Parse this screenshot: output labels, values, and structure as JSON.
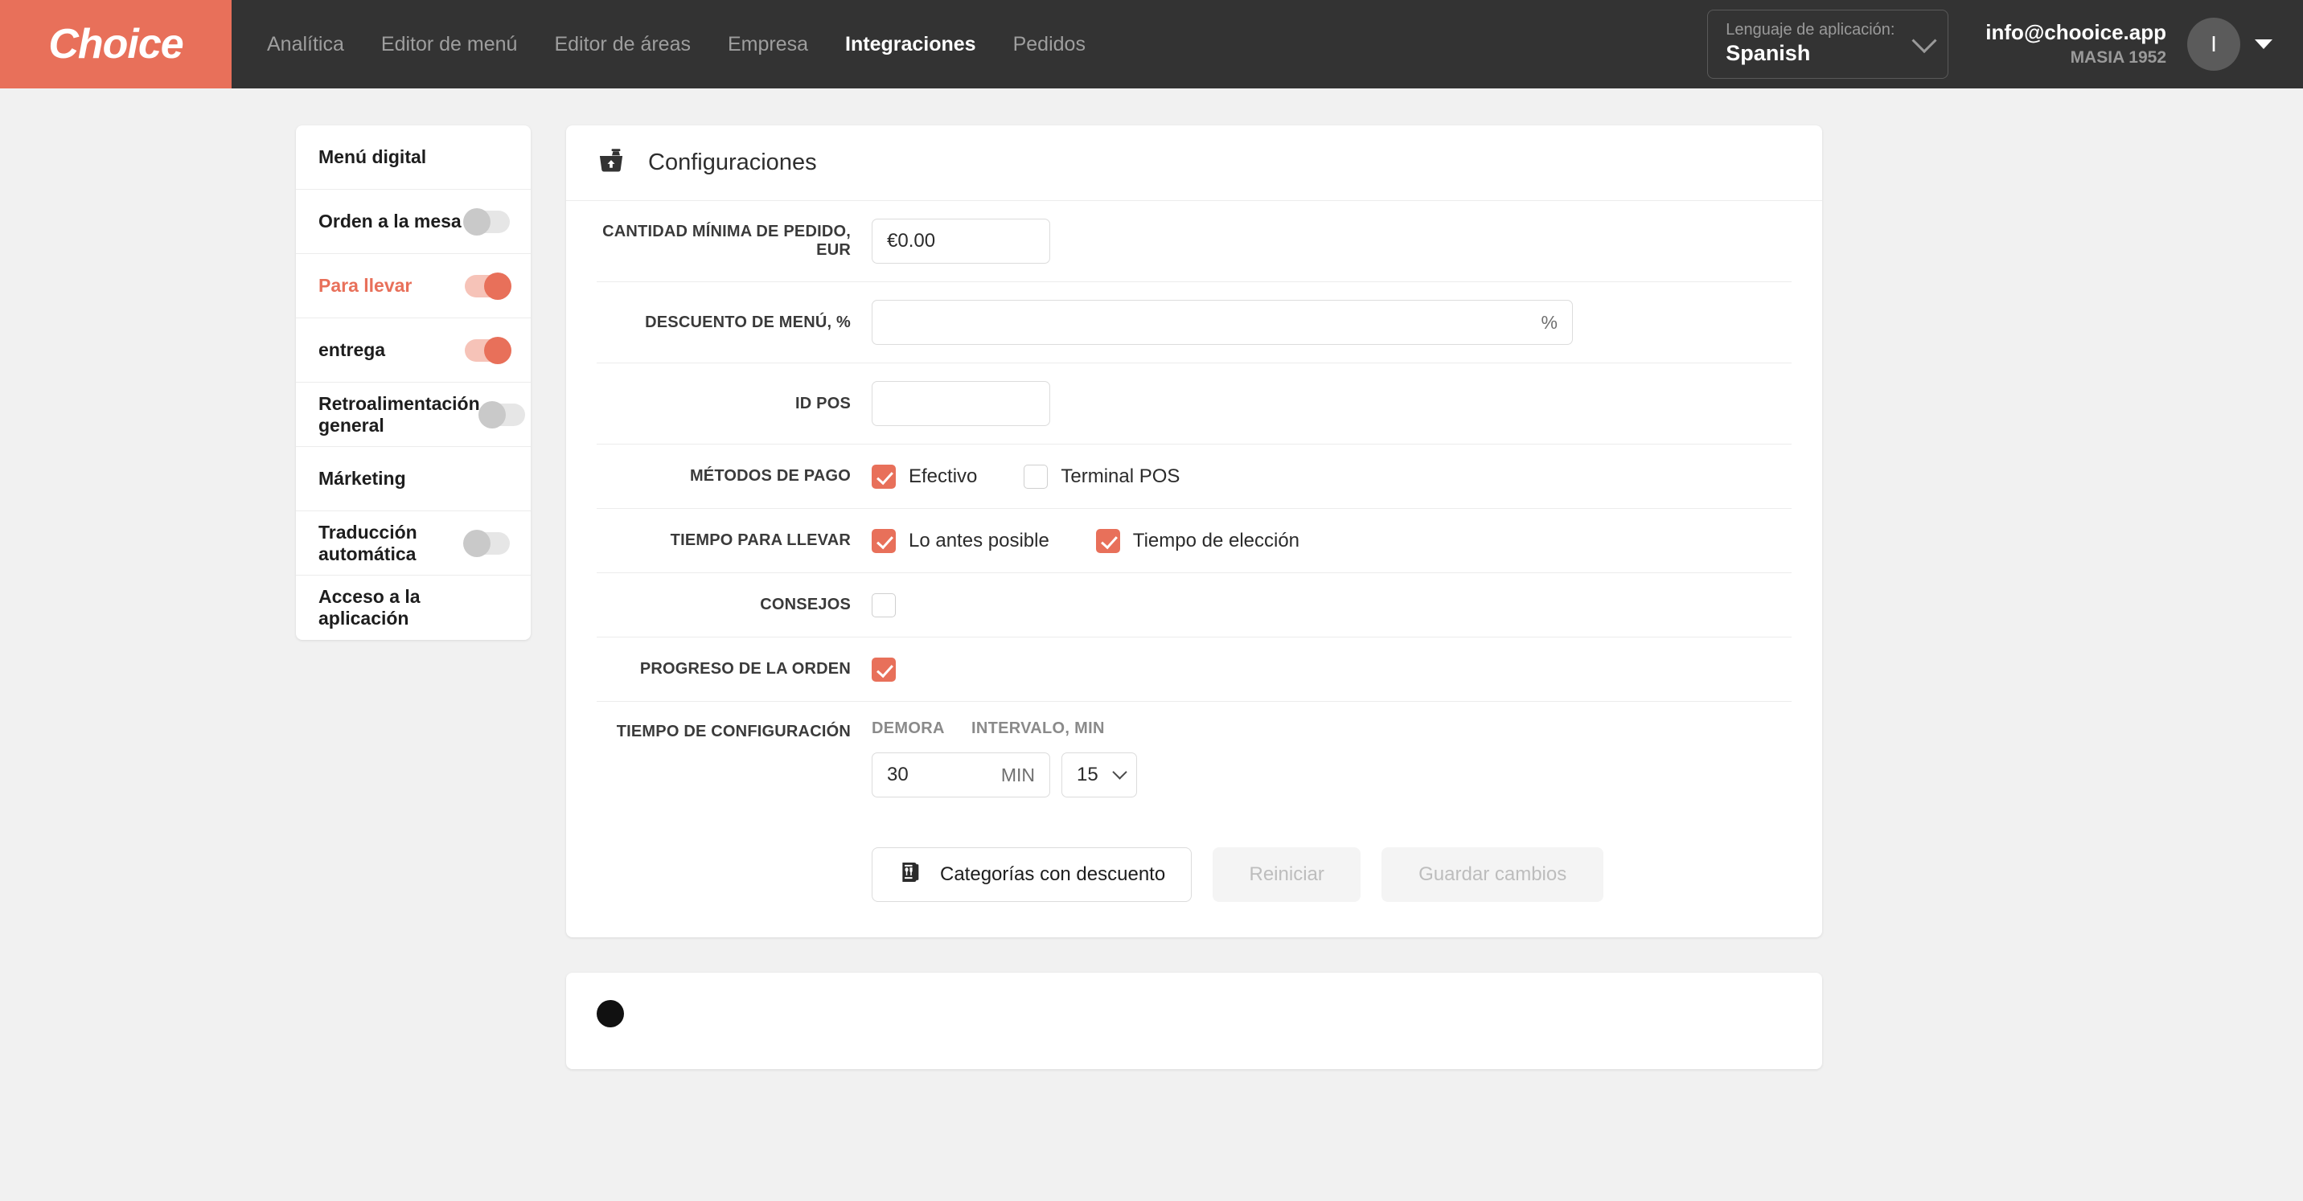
{
  "brand": {
    "logo_text": "Choice",
    "accent": "#E8705A",
    "header_bg": "#333333"
  },
  "topnav": {
    "items": [
      {
        "label": "Analítica",
        "active": false
      },
      {
        "label": "Editor de menú",
        "active": false
      },
      {
        "label": "Editor de áreas",
        "active": false
      },
      {
        "label": "Empresa",
        "active": false
      },
      {
        "label": "Integraciones",
        "active": true
      },
      {
        "label": "Pedidos",
        "active": false
      }
    ],
    "language": {
      "label": "Lenguaje de aplicación:",
      "value": "Spanish"
    },
    "account": {
      "email": "info@chooice.app",
      "org": "MASIA 1952",
      "avatar_initial": "I"
    }
  },
  "sidebar": {
    "items": [
      {
        "label": "Menú digital",
        "toggle": null,
        "active": false
      },
      {
        "label": "Orden a la mesa",
        "toggle": "off",
        "active": false
      },
      {
        "label": "Para llevar",
        "toggle": "on",
        "active": true
      },
      {
        "label": "entrega",
        "toggle": "on",
        "active": false
      },
      {
        "label": "Retroalimentación general",
        "toggle": "off",
        "active": false
      },
      {
        "label": "Márketing",
        "toggle": null,
        "active": false
      },
      {
        "label": "Traducción automática",
        "toggle": "off",
        "active": false
      },
      {
        "label": "Acceso a la aplicación",
        "toggle": null,
        "active": false
      }
    ]
  },
  "settings_card": {
    "icon": "takeaway-bag-icon",
    "title": "Configuraciones",
    "min_order": {
      "label": "CANTIDAD MÍNIMA DE PEDIDO, EUR",
      "value": "€0.00"
    },
    "menu_discount": {
      "label": "DESCUENTO DE MENÚ, %",
      "value": "",
      "suffix": "%"
    },
    "pos_id": {
      "label": "ID POS",
      "value": ""
    },
    "payment_methods": {
      "label": "MÉTODOS DE PAGO",
      "options": [
        {
          "label": "Efectivo",
          "checked": true
        },
        {
          "label": "Terminal POS",
          "checked": false
        }
      ]
    },
    "takeaway_time": {
      "label": "TIEMPO PARA LLEVAR",
      "options": [
        {
          "label": "Lo antes posible",
          "checked": true
        },
        {
          "label": "Tiempo de elección",
          "checked": true
        }
      ]
    },
    "tips": {
      "label": "CONSEJOS",
      "checked": false
    },
    "order_progress": {
      "label": "PROGRESO DE LA ORDEN",
      "checked": true
    },
    "time_config": {
      "label": "TIEMPO DE CONFIGURACIÓN",
      "delay": {
        "header": "DEMORA",
        "value": "30",
        "unit": "MIN"
      },
      "interval": {
        "header": "INTERVALO, MIN",
        "value": "15"
      }
    },
    "buttons": {
      "discount_categories": "Categorías con descuento",
      "reset": "Reiniciar",
      "save": "Guardar cambios"
    }
  }
}
